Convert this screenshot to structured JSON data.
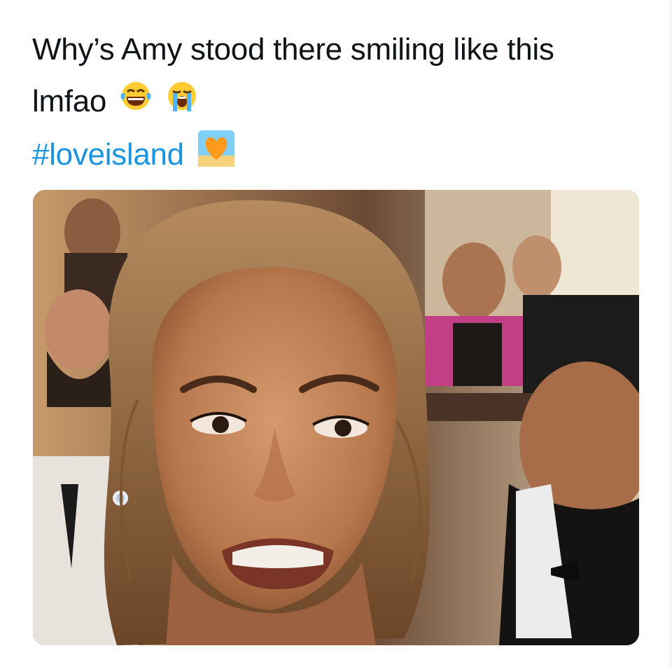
{
  "tweet": {
    "line1": "Why’s Amy stood there smiling like this",
    "line2": "lmfao",
    "hashtag": "#loveisland",
    "emojis": [
      "face-with-tears-of-joy-icon",
      "loudly-crying-face-icon",
      "orange-heart-beach-icon"
    ]
  },
  "media": {
    "type": "photo",
    "subject_icon": "crying-woman-photo"
  },
  "colors": {
    "text": "#0f1419",
    "hashtag": "#1b95e0",
    "background": "#ffffff"
  }
}
